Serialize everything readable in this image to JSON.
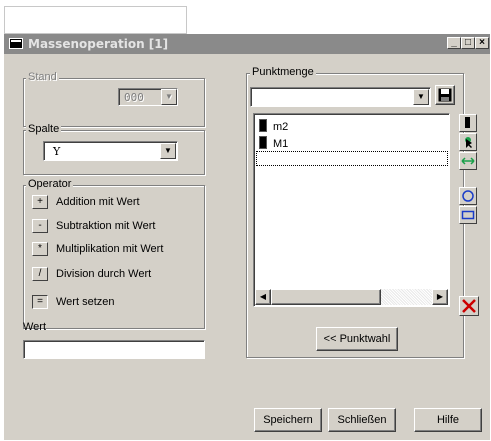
{
  "window": {
    "title": "Massenoperation [1]"
  },
  "stand": {
    "label": "Stand",
    "value": "000"
  },
  "spalte": {
    "label": "Spalte",
    "value": "Y"
  },
  "operator": {
    "label": "Operator",
    "items": [
      {
        "symbol": "+",
        "label": "Addition mit Wert"
      },
      {
        "symbol": "-",
        "label": "Subtraktion mit Wert"
      },
      {
        "symbol": "*",
        "label": "Multiplikation mit Wert"
      },
      {
        "symbol": "/",
        "label": "Division durch Wert"
      },
      {
        "symbol": "=",
        "label": "Wert setzen"
      }
    ]
  },
  "wert": {
    "label": "Wert",
    "value": ""
  },
  "punktmenge": {
    "label": "Punktmenge",
    "selected": "",
    "items": [
      "m2",
      "M1"
    ]
  },
  "buttons": {
    "punktwahl": "<< Punktwahl",
    "speichern": "Speichern",
    "schliessen": "Schließen",
    "hilfe": "Hilfe"
  },
  "colors": {
    "titlebar": "#8a8a8a",
    "face": "#d4d0c8",
    "delete": "#cc0000",
    "shape": "#1a3cc8"
  }
}
